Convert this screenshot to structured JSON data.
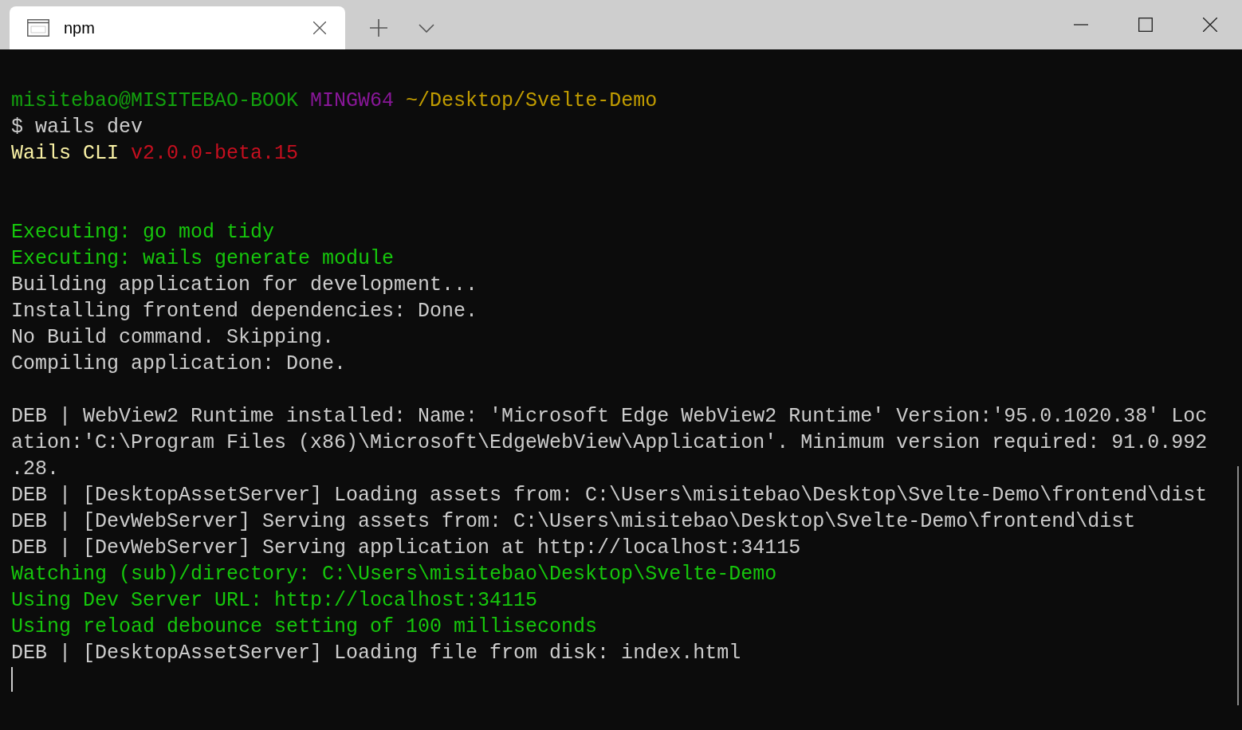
{
  "tabs": [
    {
      "title": "npm",
      "selected": true
    }
  ],
  "terminal": {
    "lines": [
      {
        "kind": "text",
        "segments": [
          {
            "text": "misitebao@MISITEBAO-BOOK",
            "color": "#13a10e"
          },
          {
            "text": "MINGW64",
            "color": "#881798"
          },
          {
            "text": "~/Desktop/Svelte-Demo",
            "color": "#c19c00"
          }
        ]
      },
      {
        "kind": "text",
        "segments": [
          {
            "text": "$ wails dev",
            "color": "#cccccc"
          }
        ]
      },
      {
        "kind": "text",
        "segments": [
          {
            "text": "Wails CLI",
            "color": "#f9f1a5"
          },
          {
            "text": "v2.0.0-beta.15",
            "color": "#c50f1f"
          }
        ]
      },
      {
        "kind": "blank"
      },
      {
        "kind": "blank"
      },
      {
        "kind": "text",
        "segments": [
          {
            "text": "Executing: go mod tidy",
            "color": "#16c60c"
          }
        ]
      },
      {
        "kind": "text",
        "segments": [
          {
            "text": "Executing: wails generate module",
            "color": "#16c60c"
          }
        ]
      },
      {
        "kind": "text",
        "segments": [
          {
            "text": "Building application for development...",
            "color": "#cccccc"
          }
        ]
      },
      {
        "kind": "text",
        "segments": [
          {
            "text": "Installing frontend dependencies: Done.",
            "color": "#cccccc"
          }
        ]
      },
      {
        "kind": "text",
        "segments": [
          {
            "text": "No Build command. Skipping.",
            "color": "#cccccc"
          }
        ]
      },
      {
        "kind": "text",
        "segments": [
          {
            "text": "Compiling application: Done.",
            "color": "#cccccc"
          }
        ]
      },
      {
        "kind": "blank"
      },
      {
        "kind": "text",
        "segments": [
          {
            "text": "DEB | WebView2 Runtime installed: Name: 'Microsoft Edge WebView2 Runtime' Version:'95.0.1020.38' Loc",
            "color": "#cccccc"
          }
        ]
      },
      {
        "kind": "text",
        "segments": [
          {
            "text": "ation:'C:\\Program Files (x86)\\Microsoft\\EdgeWebView\\Application'. Minimum version required: 91.0.992",
            "color": "#cccccc"
          }
        ]
      },
      {
        "kind": "text",
        "segments": [
          {
            "text": ".28.",
            "color": "#cccccc"
          }
        ]
      },
      {
        "kind": "text",
        "segments": [
          {
            "text": "DEB | [DesktopAssetServer] Loading assets from: C:\\Users\\misitebao\\Desktop\\Svelte-Demo\\frontend\\dist",
            "color": "#cccccc"
          }
        ]
      },
      {
        "kind": "text",
        "segments": [
          {
            "text": "DEB | [DevWebServer] Serving assets from: C:\\Users\\misitebao\\Desktop\\Svelte-Demo\\frontend\\dist",
            "color": "#cccccc"
          }
        ]
      },
      {
        "kind": "text",
        "segments": [
          {
            "text": "DEB | [DevWebServer] Serving application at http://localhost:34115",
            "color": "#cccccc"
          }
        ]
      },
      {
        "kind": "text",
        "segments": [
          {
            "text": "Watching (sub)/directory: C:\\Users\\misitebao\\Desktop\\Svelte-Demo",
            "color": "#16c60c"
          }
        ]
      },
      {
        "kind": "text",
        "segments": [
          {
            "text": "Using Dev Server URL: http://localhost:34115",
            "color": "#16c60c"
          }
        ]
      },
      {
        "kind": "text",
        "segments": [
          {
            "text": "Using reload debounce setting of 100 milliseconds",
            "color": "#16c60c"
          }
        ]
      },
      {
        "kind": "text",
        "segments": [
          {
            "text": "DEB | [DesktopAssetServer] Loading file from disk: index.html",
            "color": "#cccccc"
          }
        ]
      },
      {
        "kind": "cursor"
      }
    ]
  }
}
